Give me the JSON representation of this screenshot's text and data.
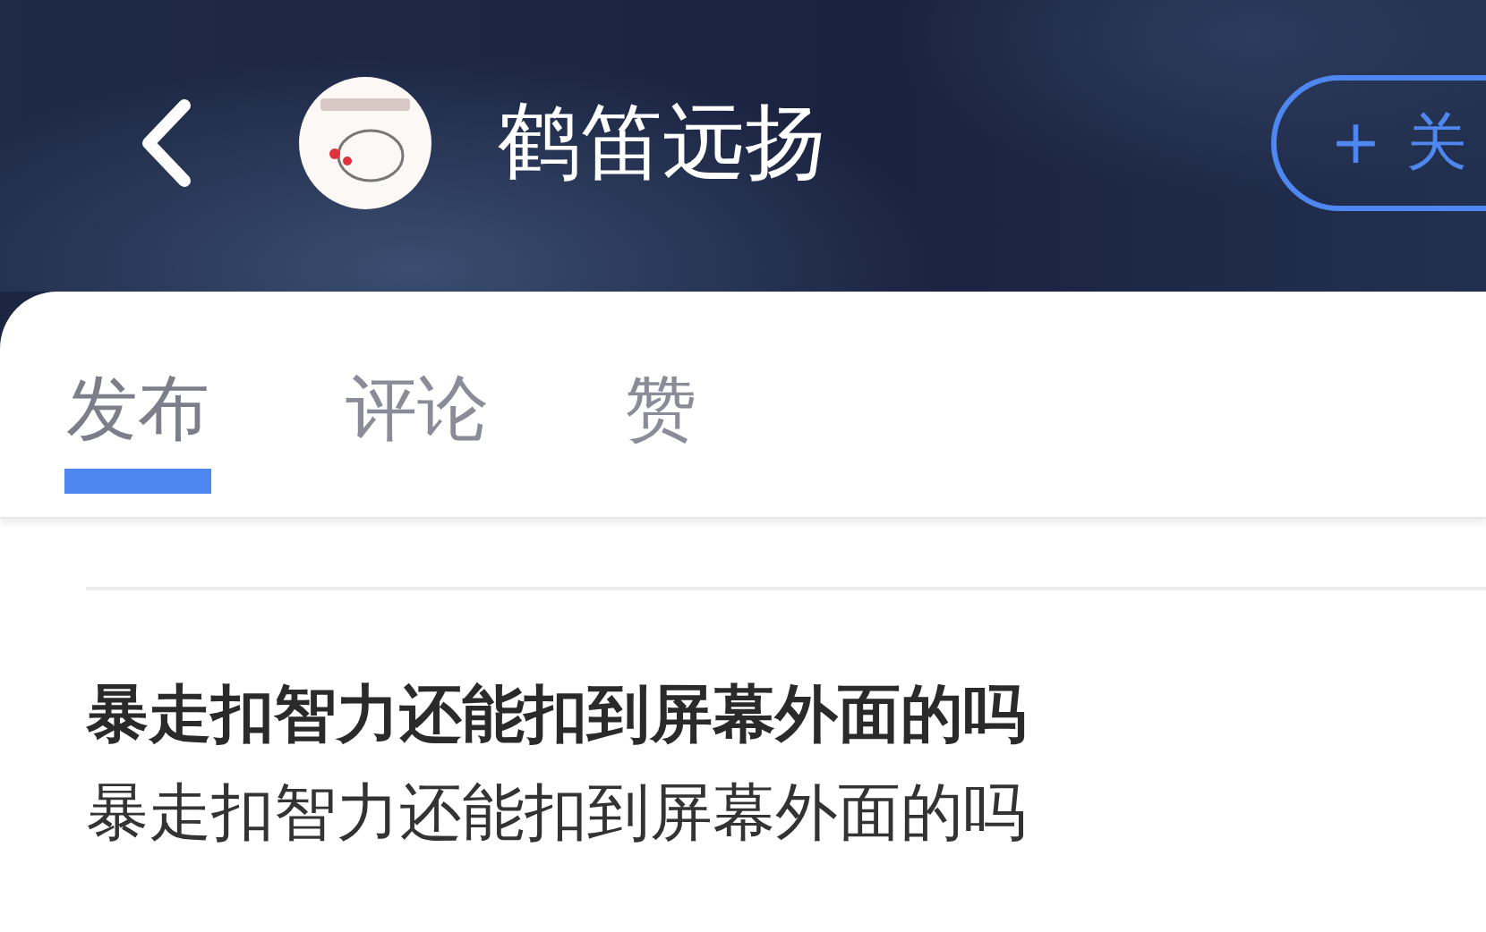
{
  "header": {
    "title": "鹤笛远扬",
    "follow_button": {
      "icon": "+",
      "label": "关"
    }
  },
  "tabs": [
    {
      "label": "发布",
      "selected": true
    },
    {
      "label": "评论",
      "selected": false
    },
    {
      "label": "赞",
      "selected": false
    }
  ],
  "posts": [
    {
      "title": "暴走扣智力还能扣到屏幕外面的吗",
      "body": "暴走扣智力还能扣到屏幕外面的吗"
    }
  ]
}
